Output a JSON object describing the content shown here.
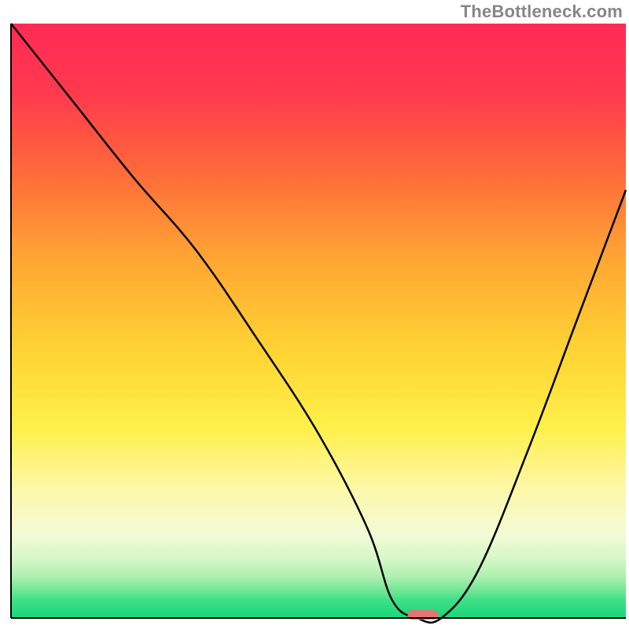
{
  "watermark": "TheBottleneck.com",
  "chart_data": {
    "type": "line",
    "title": "",
    "xlabel": "",
    "ylabel": "",
    "xlim": [
      0,
      100
    ],
    "ylim": [
      0,
      100
    ],
    "grid": false,
    "legend": false,
    "gradient_stops": [
      {
        "y": 0,
        "color": "#ff2a55"
      },
      {
        "y": 12,
        "color": "#ff3a4d"
      },
      {
        "y": 25,
        "color": "#ff6a3a"
      },
      {
        "y": 40,
        "color": "#ffa733"
      },
      {
        "y": 55,
        "color": "#ffd333"
      },
      {
        "y": 68,
        "color": "#fff04a"
      },
      {
        "y": 78,
        "color": "#fdf7a6"
      },
      {
        "y": 86,
        "color": "#f3fbd6"
      },
      {
        "y": 90,
        "color": "#d6f7c6"
      },
      {
        "y": 93,
        "color": "#aef0b0"
      },
      {
        "y": 95,
        "color": "#7be89a"
      },
      {
        "y": 97,
        "color": "#3fdf86"
      },
      {
        "y": 100,
        "color": "#17d77b"
      }
    ],
    "series": [
      {
        "name": "bottleneck-curve",
        "x": [
          0,
          10,
          20,
          30,
          40,
          50,
          58,
          62,
          66,
          70,
          76,
          84,
          92,
          100
        ],
        "y": [
          100,
          87,
          74,
          62,
          47,
          31,
          15,
          3,
          0,
          0,
          8,
          28,
          50,
          72
        ]
      }
    ],
    "marker": {
      "name": "optimal-marker",
      "x": 67,
      "y": 0,
      "color": "#e57373",
      "width": 5,
      "height": 1.6
    },
    "axes": {
      "color": "#000000",
      "width": 2
    }
  }
}
